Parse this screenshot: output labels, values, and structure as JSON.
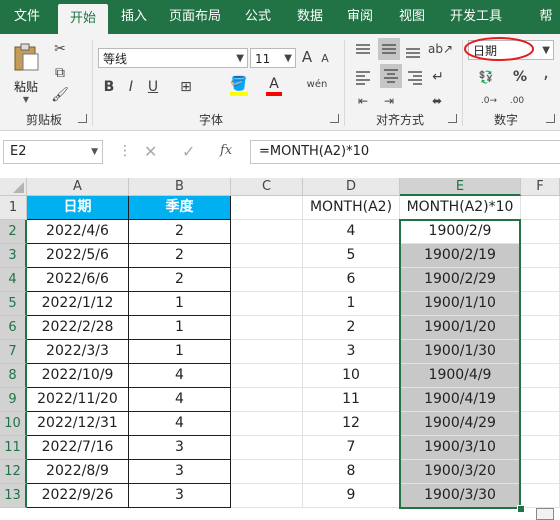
{
  "menu": {
    "tabs": [
      "文件",
      "开始",
      "插入",
      "页面布局",
      "公式",
      "数据",
      "审阅",
      "视图",
      "开发工具",
      "帮"
    ],
    "active_index": 1
  },
  "ribbon": {
    "clipboard": {
      "paste_label": "粘贴",
      "group_label": "剪贴板"
    },
    "font": {
      "font_name": "等线",
      "font_size": "11",
      "group_label": "字体",
      "bold": "B",
      "italic": "I",
      "underline": "U",
      "grow": "A",
      "shrink": "A",
      "phonetic": "wén"
    },
    "alignment": {
      "group_label": "对齐方式"
    },
    "number": {
      "format": "日期",
      "group_label": "数字",
      "percent": "%",
      "comma": ","
    }
  },
  "formula_bar": {
    "name_box": "E2",
    "formula": "=MONTH(A2)*10",
    "fx": "fx"
  },
  "grid": {
    "columns": [
      "A",
      "B",
      "C",
      "D",
      "E",
      "F"
    ],
    "selected_column": "E",
    "header_row": {
      "A": "日期",
      "B": "季度",
      "D": "MONTH(A2)",
      "E": "MONTH(A2)*10"
    },
    "rows": [
      {
        "n": "2",
        "A": "2022/4/6",
        "B": "2",
        "D": "4",
        "E": "1900/2/9"
      },
      {
        "n": "3",
        "A": "2022/5/6",
        "B": "2",
        "D": "5",
        "E": "1900/2/19"
      },
      {
        "n": "4",
        "A": "2022/6/6",
        "B": "2",
        "D": "6",
        "E": "1900/2/29"
      },
      {
        "n": "5",
        "A": "2022/1/12",
        "B": "1",
        "D": "1",
        "E": "1900/1/10"
      },
      {
        "n": "6",
        "A": "2022/2/28",
        "B": "1",
        "D": "2",
        "E": "1900/1/20"
      },
      {
        "n": "7",
        "A": "2022/3/3",
        "B": "1",
        "D": "3",
        "E": "1900/1/30"
      },
      {
        "n": "8",
        "A": "2022/10/9",
        "B": "4",
        "D": "10",
        "E": "1900/4/9"
      },
      {
        "n": "9",
        "A": "2022/11/20",
        "B": "4",
        "D": "11",
        "E": "1900/4/19"
      },
      {
        "n": "10",
        "A": "2022/12/31",
        "B": "4",
        "D": "12",
        "E": "1900/4/29"
      },
      {
        "n": "11",
        "A": "2022/7/16",
        "B": "3",
        "D": "7",
        "E": "1900/3/10"
      },
      {
        "n": "12",
        "A": "2022/8/9",
        "B": "3",
        "D": "8",
        "E": "1900/3/20"
      },
      {
        "n": "13",
        "A": "2022/9/26",
        "B": "3",
        "D": "9",
        "E": "1900/3/30"
      }
    ]
  },
  "colors": {
    "accent": "#217346",
    "header_fill": "#00b0f0",
    "selection_fill": "#c8c8c8",
    "highlight_ring": "#e02020"
  }
}
